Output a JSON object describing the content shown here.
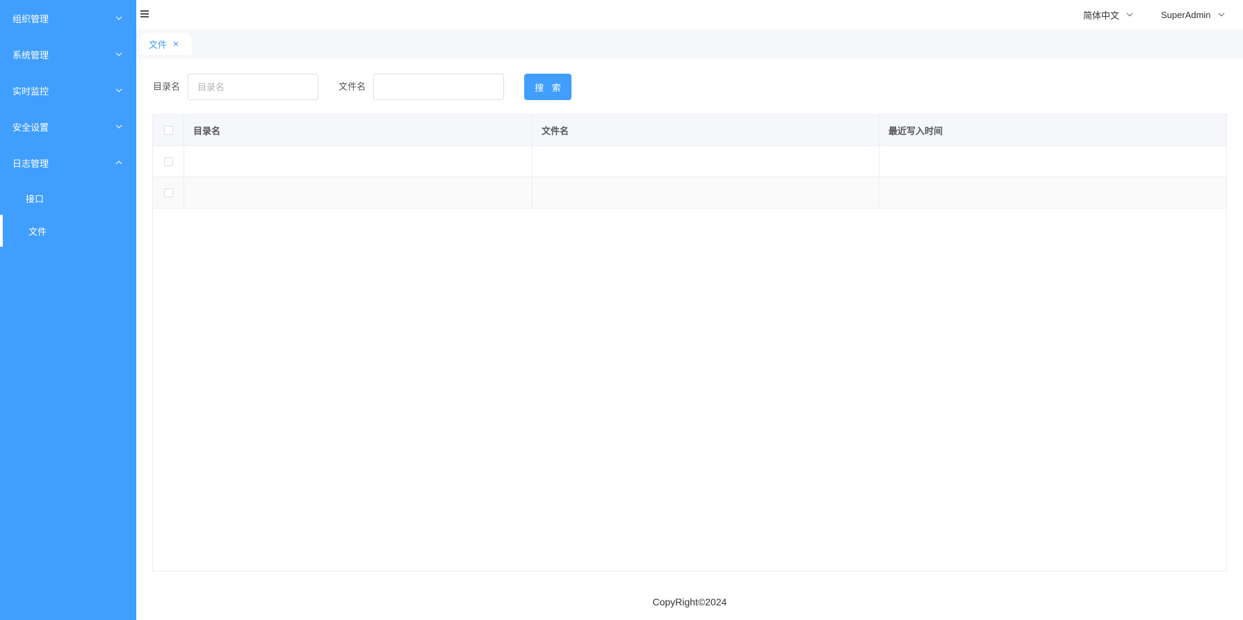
{
  "sidebar": {
    "bg_color": "#409eff",
    "items": [
      {
        "label": "组织管理",
        "expanded": false
      },
      {
        "label": "系统管理",
        "expanded": false
      },
      {
        "label": "实时监控",
        "expanded": false
      },
      {
        "label": "安全设置",
        "expanded": false
      },
      {
        "label": "日志管理",
        "expanded": true
      }
    ],
    "sub_items": [
      {
        "label": "接口",
        "active": false
      },
      {
        "label": "文件",
        "active": true
      }
    ]
  },
  "header": {
    "menu_icon": "hamburger-icon",
    "language": "简体中文",
    "user": "SuperAdmin"
  },
  "tabs": [
    {
      "label": "文件",
      "active": true,
      "closable": true
    }
  ],
  "search": {
    "dir_label": "目录名",
    "dir_placeholder": "目录名",
    "dir_value": "",
    "file_label": "文件名",
    "file_placeholder": "",
    "file_value": "",
    "button_label": "搜 索"
  },
  "table": {
    "columns": [
      "目录名",
      "文件名",
      "最近写入时间"
    ],
    "rows": [
      {
        "dir": "",
        "file": "",
        "time": ""
      },
      {
        "dir": "",
        "file": "",
        "time": ""
      }
    ]
  },
  "footer": {
    "copyright": "CopyRight©2024"
  },
  "colors": {
    "primary": "#409eff",
    "header_bg": "#f5f7fa",
    "border": "#ebeef5"
  }
}
